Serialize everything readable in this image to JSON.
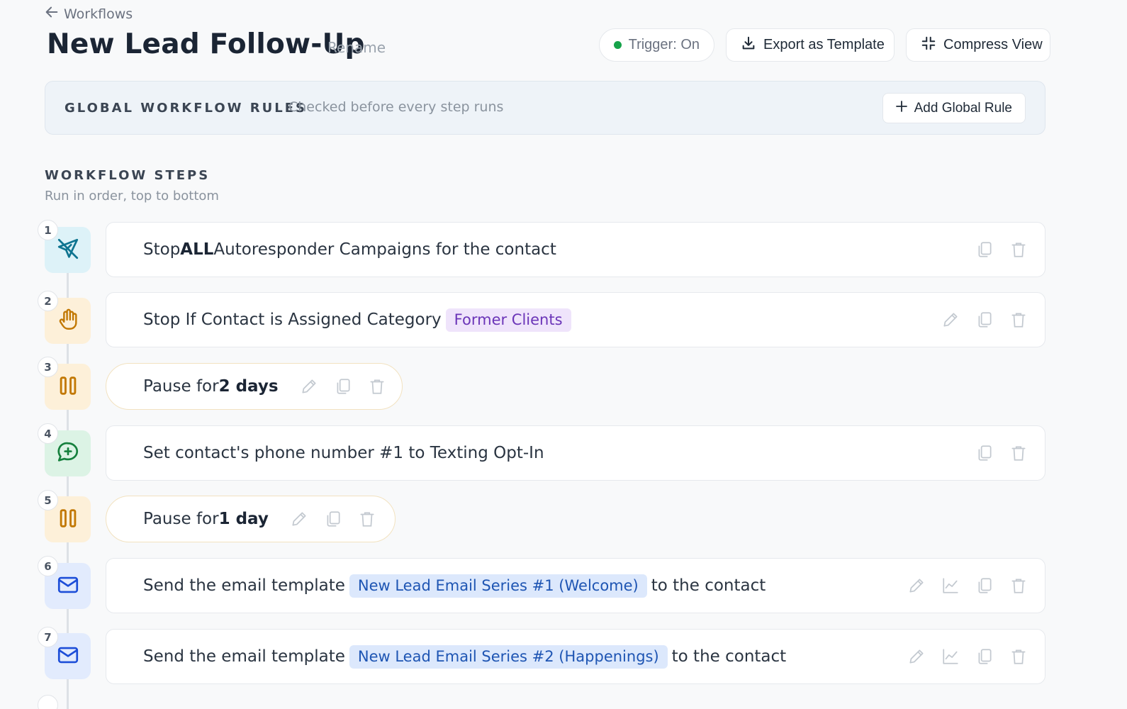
{
  "nav": {
    "back_label": "Workflows"
  },
  "header": {
    "title": "New Lead Follow-Up",
    "rename_label": "Rename",
    "trigger_label": "Trigger: On",
    "export_label": "Export as Template",
    "compress_label": "Compress View",
    "colors": {
      "trigger_dot": "#16a34a"
    }
  },
  "global_rules": {
    "label": "GLOBAL WORKFLOW RULES",
    "subtitle": "Checked before every step runs",
    "add_label": "Add Global Rule"
  },
  "steps_section": {
    "title": "WORKFLOW STEPS",
    "subtitle": "Run in order, top to bottom"
  },
  "steps": [
    {
      "num": "1",
      "icon": "send-off-icon",
      "pre": "Stop ",
      "bold": "ALL",
      "post": " Autoresponder Campaigns for the contact",
      "actions": [
        "copy",
        "delete"
      ]
    },
    {
      "num": "2",
      "icon": "hand-stop-icon",
      "pre": "Stop If Contact is Assigned Category",
      "tag": "Former Clients",
      "actions": [
        "edit",
        "copy",
        "delete"
      ]
    },
    {
      "num": "3",
      "icon": "pause-icon",
      "pre": "Pause for ",
      "bold": "2 days",
      "actions": [
        "edit",
        "copy",
        "delete"
      ]
    },
    {
      "num": "4",
      "icon": "message-plus-icon",
      "pre": "Set contact's phone number #1 to Texting Opt-In",
      "actions": [
        "copy",
        "delete"
      ]
    },
    {
      "num": "5",
      "icon": "pause-icon",
      "pre": "Pause for ",
      "bold": "1 day",
      "actions": [
        "edit",
        "copy",
        "delete"
      ]
    },
    {
      "num": "6",
      "icon": "mail-icon",
      "pre": "Send the email template",
      "tag": "New Lead Email Series #1 (Welcome)",
      "post": "to the contact",
      "actions": [
        "edit",
        "stats",
        "copy",
        "delete"
      ]
    },
    {
      "num": "7",
      "icon": "mail-icon",
      "pre": "Send the email template",
      "tag": "New Lead Email Series #2 (Happenings)",
      "post": "to the contact",
      "actions": [
        "edit",
        "stats",
        "copy",
        "delete"
      ]
    }
  ]
}
